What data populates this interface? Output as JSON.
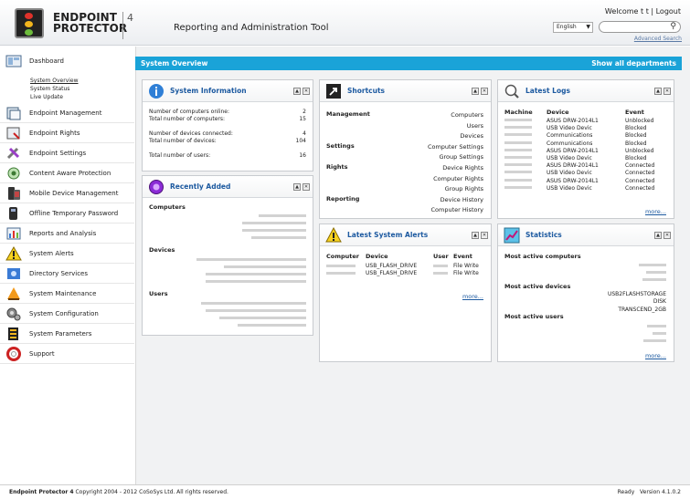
{
  "header": {
    "brand_line1": "ENDPOINT",
    "brand_line2": "PROTECTOR",
    "brand_version": "4",
    "app_title": "Reporting and Administration Tool",
    "welcome": "Welcome t t",
    "logout": "Logout",
    "language": "English",
    "advanced_search": "Advanced Search"
  },
  "sidebar": {
    "items": [
      {
        "label": "Dashboard",
        "icon": "dashboard-icon"
      },
      {
        "label": "Endpoint Management",
        "icon": "endpoint-management-icon"
      },
      {
        "label": "Endpoint Rights",
        "icon": "endpoint-rights-icon"
      },
      {
        "label": "Endpoint Settings",
        "icon": "endpoint-settings-icon"
      },
      {
        "label": "Content Aware Protection",
        "icon": "content-aware-icon"
      },
      {
        "label": "Mobile Device Management",
        "icon": "mobile-device-icon"
      },
      {
        "label": "Offline Temporary Password",
        "icon": "offline-password-icon"
      },
      {
        "label": "Reports and Analysis",
        "icon": "reports-icon"
      },
      {
        "label": "System Alerts",
        "icon": "alert-icon"
      },
      {
        "label": "Directory Services",
        "icon": "directory-icon"
      },
      {
        "label": "System Maintenance",
        "icon": "maintenance-icon"
      },
      {
        "label": "System Configuration",
        "icon": "configuration-icon"
      },
      {
        "label": "System Parameters",
        "icon": "parameters-icon"
      },
      {
        "label": "Support",
        "icon": "support-icon"
      }
    ],
    "subnav": [
      "System Overview",
      "System Status",
      "Live Update"
    ]
  },
  "overview": {
    "title": "System Overview",
    "show_all": "Show all departments"
  },
  "system_info": {
    "title": "System Information",
    "rows": [
      {
        "label": "Number of computers online:",
        "value": "2"
      },
      {
        "label": "Total number of computers:",
        "value": "15"
      },
      {
        "label": "Number of devices connected:",
        "value": "4"
      },
      {
        "label": "Total number of devices:",
        "value": "104"
      },
      {
        "label": "Total number of users:",
        "value": "16"
      }
    ]
  },
  "recently_added": {
    "title": "Recently Added",
    "computers_label": "Computers",
    "devices_label": "Devices",
    "users_label": "Users"
  },
  "shortcuts": {
    "title": "Shortcuts",
    "groups": [
      {
        "label": "Management",
        "links": [
          "Computers",
          "Users",
          "Devices"
        ]
      },
      {
        "label": "Settings",
        "links": [
          "Computer Settings",
          "Group Settings"
        ]
      },
      {
        "label": "Rights",
        "links": [
          "Device Rights",
          "Computer Rights",
          "Group Rights"
        ]
      },
      {
        "label": "Reporting",
        "links": [
          "Device History",
          "Computer History"
        ]
      }
    ]
  },
  "latest_alerts": {
    "title": "Latest System Alerts",
    "columns": [
      "Computer",
      "Device",
      "User",
      "Event"
    ],
    "rows": [
      {
        "device": "USB_FLASH_DRIVE",
        "event": "File Write"
      },
      {
        "device": "USB_FLASH_DRIVE",
        "event": "File Write"
      }
    ],
    "more": "more..."
  },
  "latest_logs": {
    "title": "Latest Logs",
    "columns": [
      "Machine",
      "Device",
      "Event"
    ],
    "rows": [
      {
        "device": "ASUS DRW-2014L1",
        "event": "Unblocked"
      },
      {
        "device": "USB Video Devic",
        "event": "Blocked"
      },
      {
        "device": "Communications",
        "event": "Blocked"
      },
      {
        "device": "Communications",
        "event": "Blocked"
      },
      {
        "device": "ASUS DRW-2014L1",
        "event": "Unblocked"
      },
      {
        "device": "USB Video Devic",
        "event": "Blocked"
      },
      {
        "device": "ASUS DRW-2014L1",
        "event": "Connected"
      },
      {
        "device": "USB Video Devic",
        "event": "Connected"
      },
      {
        "device": "ASUS DRW-2014L1",
        "event": "Connected"
      },
      {
        "device": "USB Video Devic",
        "event": "Connected"
      }
    ],
    "more": "more..."
  },
  "statistics": {
    "title": "Statistics",
    "computers_label": "Most active computers",
    "devices_label": "Most active devices",
    "devices": [
      "USB2FLASHSTORAGE",
      "DISK",
      "TRANSCEND_2GB"
    ],
    "users_label": "Most active users",
    "more": "more..."
  },
  "footer": {
    "product": "Endpoint Protector 4",
    "copyright": "Copyright 2004 - 2012 CoSoSys Ltd. All rights reserved.",
    "status": "Ready",
    "version": "Version 4.1.0.2"
  },
  "colors": {
    "accent": "#1aa3d8",
    "panel_title": "#1d5aa0"
  }
}
